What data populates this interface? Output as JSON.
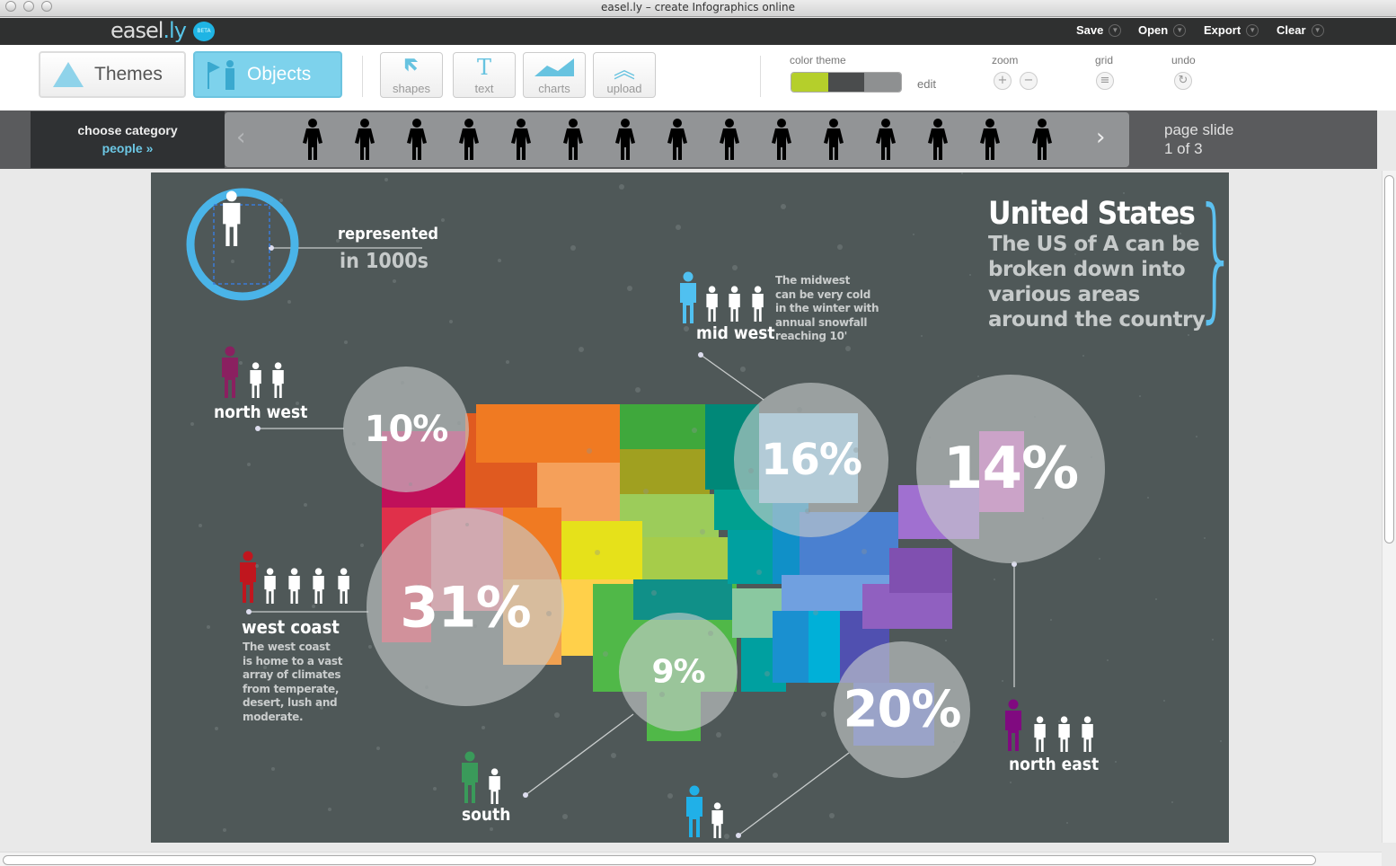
{
  "window": {
    "title": "easel.ly – create Infographics online"
  },
  "app": {
    "logo_text": "easel",
    "logo_suffix": ".ly",
    "beta_badge": "BETA"
  },
  "menu": [
    {
      "label": "Save"
    },
    {
      "label": "Open"
    },
    {
      "label": "Export"
    },
    {
      "label": "Clear"
    }
  ],
  "toolbar": {
    "themes_label": "Themes",
    "objects_label": "Objects",
    "tools": [
      {
        "label": "shapes",
        "icon": "arrow-icon"
      },
      {
        "label": "text",
        "icon": "text-icon"
      },
      {
        "label": "charts",
        "icon": "chart-icon"
      },
      {
        "label": "upload",
        "icon": "upload-icon"
      }
    ],
    "color_theme_label": "color theme",
    "color_theme_edit": "edit",
    "color_theme_swatches": [
      "#b5cf2b",
      "#4a4c4d",
      "#8e9091"
    ],
    "zoom_label": "zoom",
    "grid_label": "grid",
    "undo_label": "undo"
  },
  "category": {
    "label": "choose category",
    "value": "people »",
    "page_label": "page slide",
    "page_value": "1 of 3",
    "objects": [
      "dancer",
      "couple-men",
      "couple",
      "couple-walking",
      "family",
      "group",
      "soccer-player",
      "cyclist",
      "weightlifter",
      "skateboarder",
      "boxer",
      "runner",
      "skier",
      "basketball-player",
      "diver"
    ]
  },
  "infographic": {
    "title": "United States",
    "subtitle": [
      "The US of A can be",
      "broken down into",
      "various areas",
      "around the country"
    ],
    "legend": {
      "line1": "represented",
      "line2": "in 1000s"
    },
    "colors": {
      "background": "#4f5858",
      "accent": "#4ab4e8"
    },
    "regions": [
      {
        "name": "north west",
        "percent": "10%",
        "color": "#8a2060",
        "count": 3
      },
      {
        "name": "mid west",
        "percent": "16%",
        "color": "#50c0f0",
        "count": 4,
        "description": [
          "The midwest",
          "can be very cold",
          "in the winter with",
          "annual snowfall",
          "reaching 10'"
        ]
      },
      {
        "name": "north east",
        "percent": "14%",
        "color": "#800a80",
        "count": 4
      },
      {
        "name": "west coast",
        "percent": "31%",
        "color": "#c0161e",
        "count": 5,
        "description": [
          "The west coast",
          "is home to a vast",
          "array of climates",
          "from temperate,",
          "desert, lush and",
          "moderate."
        ]
      },
      {
        "name": "south",
        "percent": "9%",
        "color": "#3a9a5a",
        "count": 2
      },
      {
        "name": "",
        "percent": "20%",
        "color": "#20b0e8",
        "count": 2
      }
    ]
  }
}
